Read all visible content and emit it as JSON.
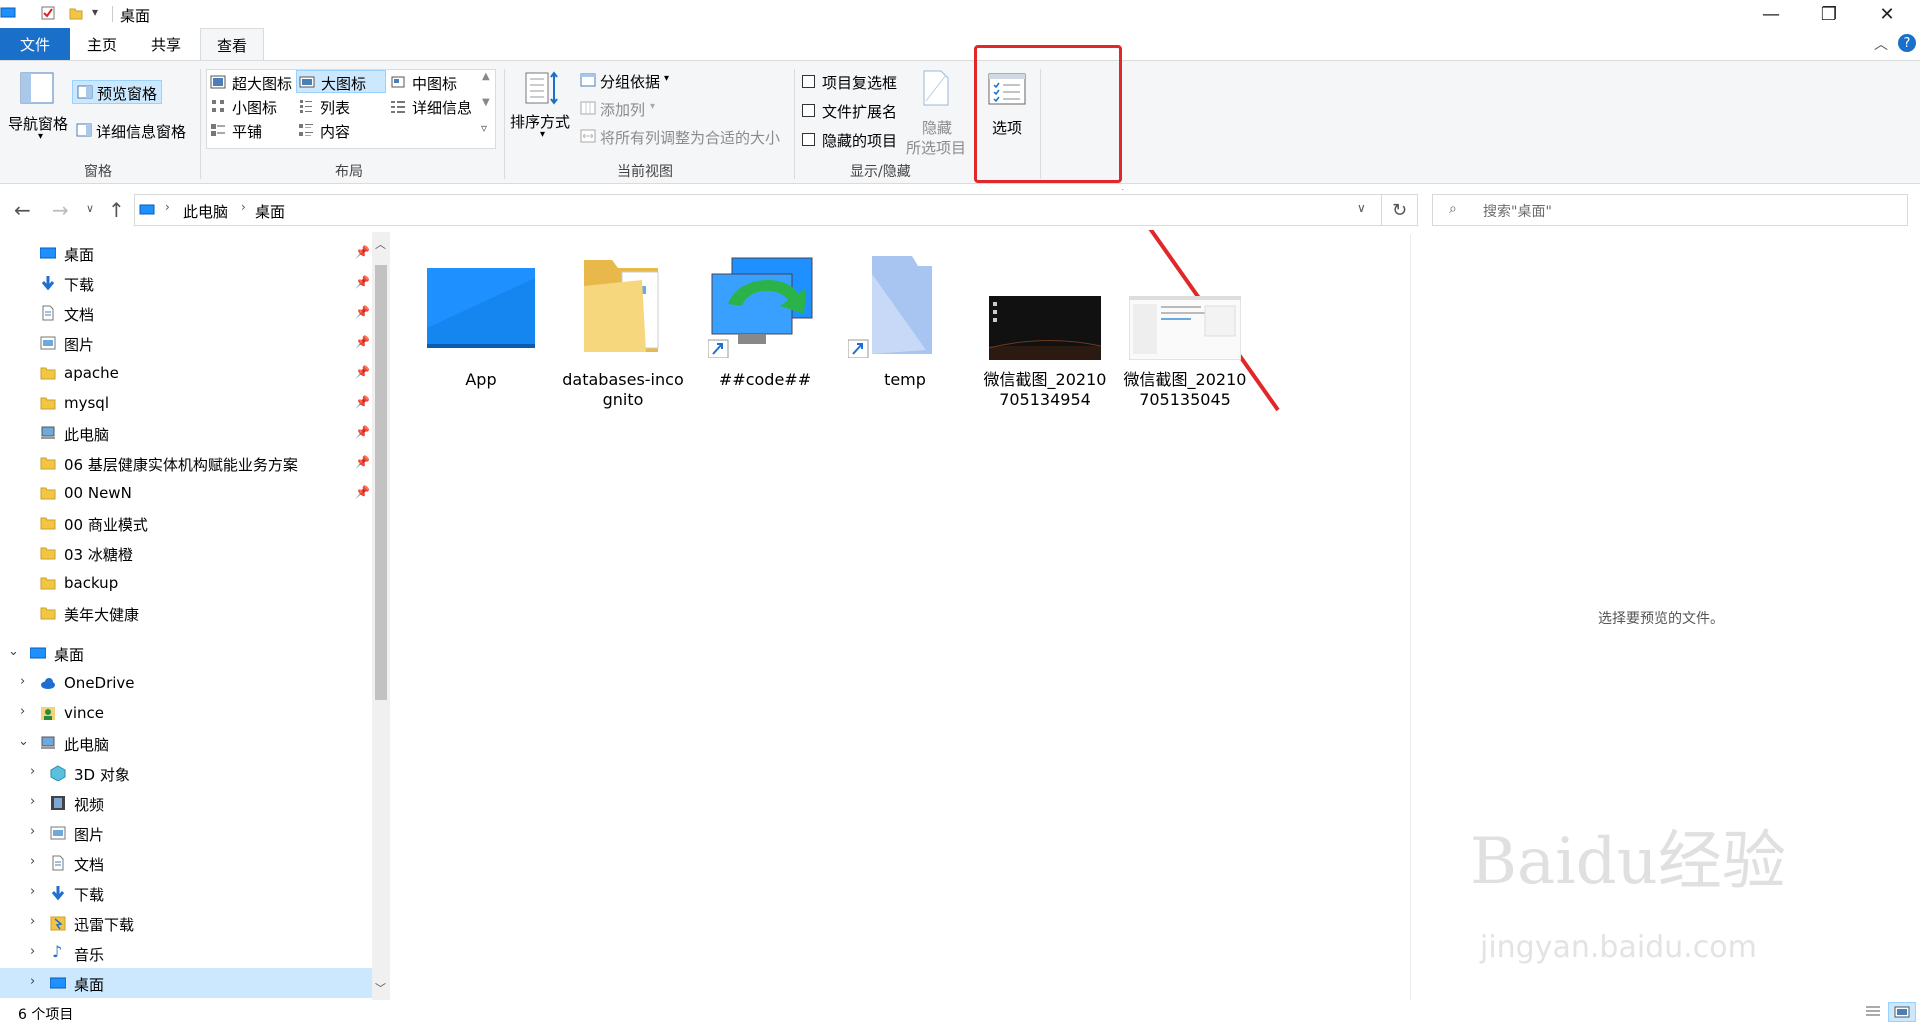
{
  "window": {
    "title": "桌面"
  },
  "tabs": {
    "file": "文件",
    "home": "主页",
    "share": "共享",
    "view": "查看"
  },
  "ribbon": {
    "panes": {
      "nav_pane": "导航窗格",
      "preview_pane": "预览窗格",
      "details_pane": "详细信息窗格",
      "group": "窗格"
    },
    "layout": {
      "extra_large": "超大图标",
      "large": "大图标",
      "medium": "中图标",
      "small": "小图标",
      "list": "列表",
      "details": "详细信息",
      "tiles": "平铺",
      "content": "内容",
      "group": "布局"
    },
    "current_view": {
      "sort_by": "排序方式",
      "group_by": "分组依据",
      "add_columns": "添加列",
      "size_all_columns": "将所有列调整为合适的大小",
      "group": "当前视图"
    },
    "show_hide": {
      "item_checkboxes": "项目复选框",
      "file_extensions": "文件扩展名",
      "hidden_items": "隐藏的项目",
      "hide_selected_1": "隐藏",
      "hide_selected_2": "所选项目",
      "group": "显示/隐藏"
    },
    "options": "选项"
  },
  "address": {
    "segments": [
      "此电脑",
      "桌面"
    ],
    "search_placeholder": "搜索\"桌面\""
  },
  "sidebar": {
    "quick_access": [
      {
        "label": "桌面",
        "pinned": true
      },
      {
        "label": "下载",
        "pinned": true
      },
      {
        "label": "文档",
        "pinned": true
      },
      {
        "label": "图片",
        "pinned": true
      },
      {
        "label": "apache",
        "pinned": true
      },
      {
        "label": "mysql",
        "pinned": true
      },
      {
        "label": "此电脑",
        "pinned": true
      },
      {
        "label": "06 基层健康实体机构赋能业务方案",
        "pinned": true
      },
      {
        "label": "00 NewN",
        "pinned": true
      },
      {
        "label": "00 商业模式",
        "pinned": false
      },
      {
        "label": "03 冰糖橙",
        "pinned": false
      },
      {
        "label": "backup",
        "pinned": false
      },
      {
        "label": "美年大健康",
        "pinned": false
      }
    ],
    "tree": [
      {
        "label": "桌面"
      },
      {
        "label": "OneDrive"
      },
      {
        "label": "vince"
      },
      {
        "label": "此电脑"
      },
      {
        "label": "3D 对象"
      },
      {
        "label": "视频"
      },
      {
        "label": "图片"
      },
      {
        "label": "文档"
      },
      {
        "label": "下载"
      },
      {
        "label": "迅雷下载"
      },
      {
        "label": "音乐"
      },
      {
        "label": "桌面"
      }
    ]
  },
  "files": [
    {
      "name": "App"
    },
    {
      "name": "databases-incognito"
    },
    {
      "name": "##code##"
    },
    {
      "name": "temp"
    },
    {
      "name": "微信截图_20210705134954"
    },
    {
      "name": "微信截图_20210705135045"
    }
  ],
  "preview": {
    "empty_text": "选择要预览的文件。"
  },
  "status": {
    "item_count": "6 个项目"
  },
  "watermark": {
    "brand": "Baidu经验",
    "url": "jingyan.baidu.com"
  },
  "colors": {
    "accent": "#1a6fc9",
    "annotation": "#e0282b",
    "selected": "#cce8ff"
  }
}
